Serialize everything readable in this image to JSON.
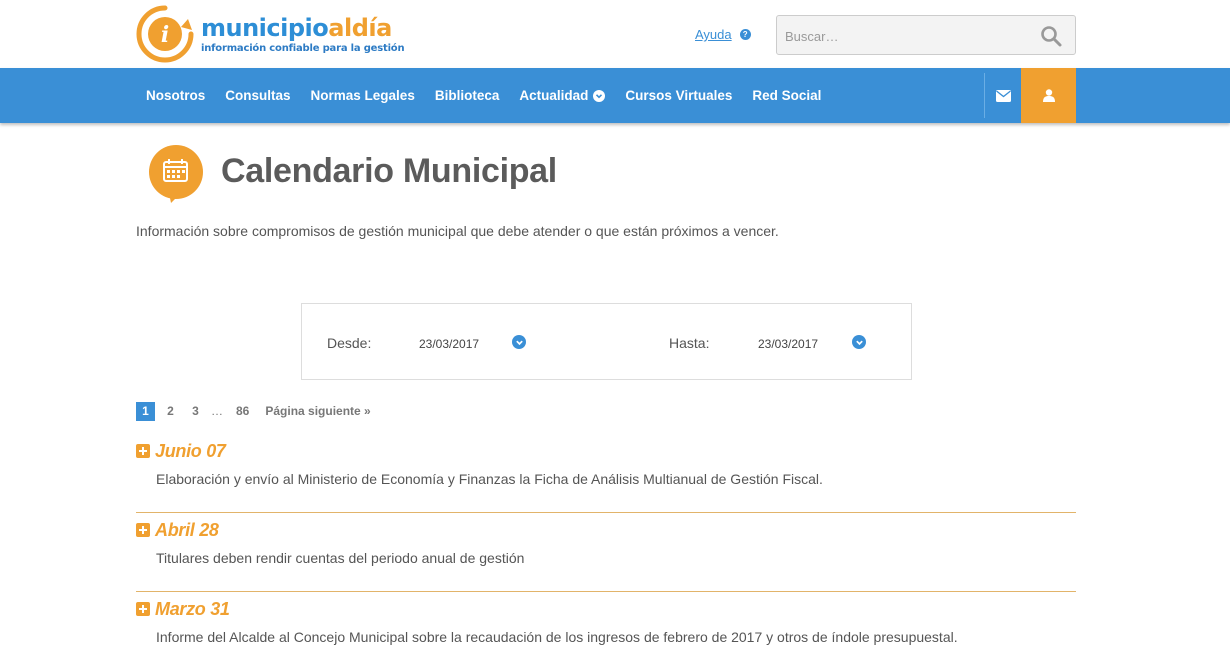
{
  "header": {
    "logo": {
      "name_part1": "municipio",
      "name_part2": "aldía",
      "tagline": "información confiable para la gestión"
    },
    "help_label": "Ayuda",
    "search": {
      "placeholder": "Buscar…"
    }
  },
  "nav": {
    "items": [
      {
        "label": "Nosotros"
      },
      {
        "label": "Consultas"
      },
      {
        "label": "Normas Legales"
      },
      {
        "label": "Biblioteca"
      },
      {
        "label": "Actualidad",
        "has_dropdown": true
      },
      {
        "label": "Cursos Virtuales"
      },
      {
        "label": "Red Social"
      }
    ],
    "icons": [
      "envelope-icon",
      "user-icon"
    ]
  },
  "page": {
    "title": "Calendario Municipal",
    "intro": "Información sobre compromisos de gestión municipal que debe atender o que están próximos a vencer."
  },
  "filter": {
    "from_label": "Desde:",
    "from_value": "23/03/2017",
    "to_label": "Hasta:",
    "to_value": "23/03/2017"
  },
  "pagination": {
    "pages": [
      "1",
      "2",
      "3"
    ],
    "active": "1",
    "ellipsis": "…",
    "last": "86",
    "next_label": "Página siguiente »"
  },
  "events": [
    {
      "date": "Junio 07",
      "description": "Elaboración y envío al Ministerio de Economía y Finanzas la Ficha de Análisis Multianual de Gestión Fiscal."
    },
    {
      "date": "Abril 28",
      "description": "Titulares deben rendir cuentas del periodo anual de gestión"
    },
    {
      "date": "Marzo 31",
      "description": "Informe del Alcalde al Concejo Municipal sobre la recaudación de los ingresos de febrero de 2017 y otros de índole presupuestal."
    }
  ],
  "colors": {
    "brand_blue": "#3a8fd6",
    "brand_orange": "#f0a030"
  }
}
